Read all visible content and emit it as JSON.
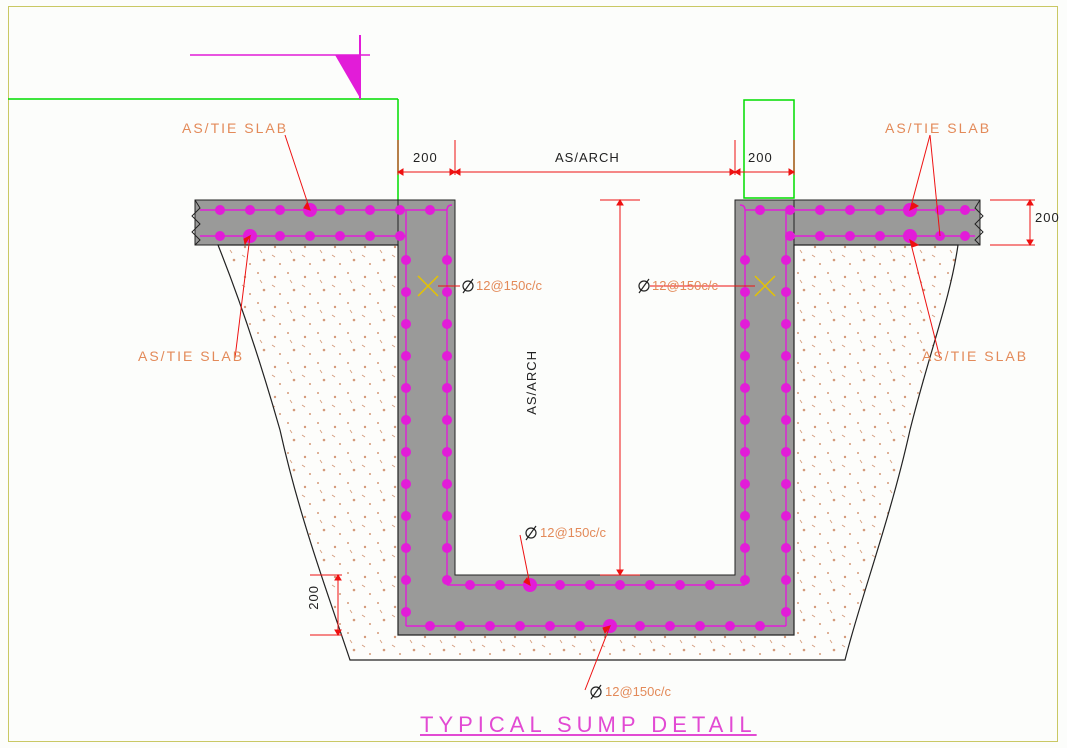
{
  "title": "TYPICAL SUMP DETAIL",
  "labels": {
    "as_tie_slab": "AS/TIE SLAB",
    "rebar_spec": "12@150c/c",
    "dim200": "200",
    "as_arch": "AS/ARCH"
  },
  "colors": {
    "magenta": "#e21cd8",
    "orange": "#e38a59",
    "red": "#e11",
    "green": "#0d0",
    "grey": "#9a9a99",
    "border": "#c9c864"
  },
  "dimensions": {
    "wall_thickness": 200,
    "slab_thickness": 200,
    "base_thickness": 200,
    "inner_width_note": "AS/ARCH",
    "inner_depth_note": "AS/ARCH"
  }
}
